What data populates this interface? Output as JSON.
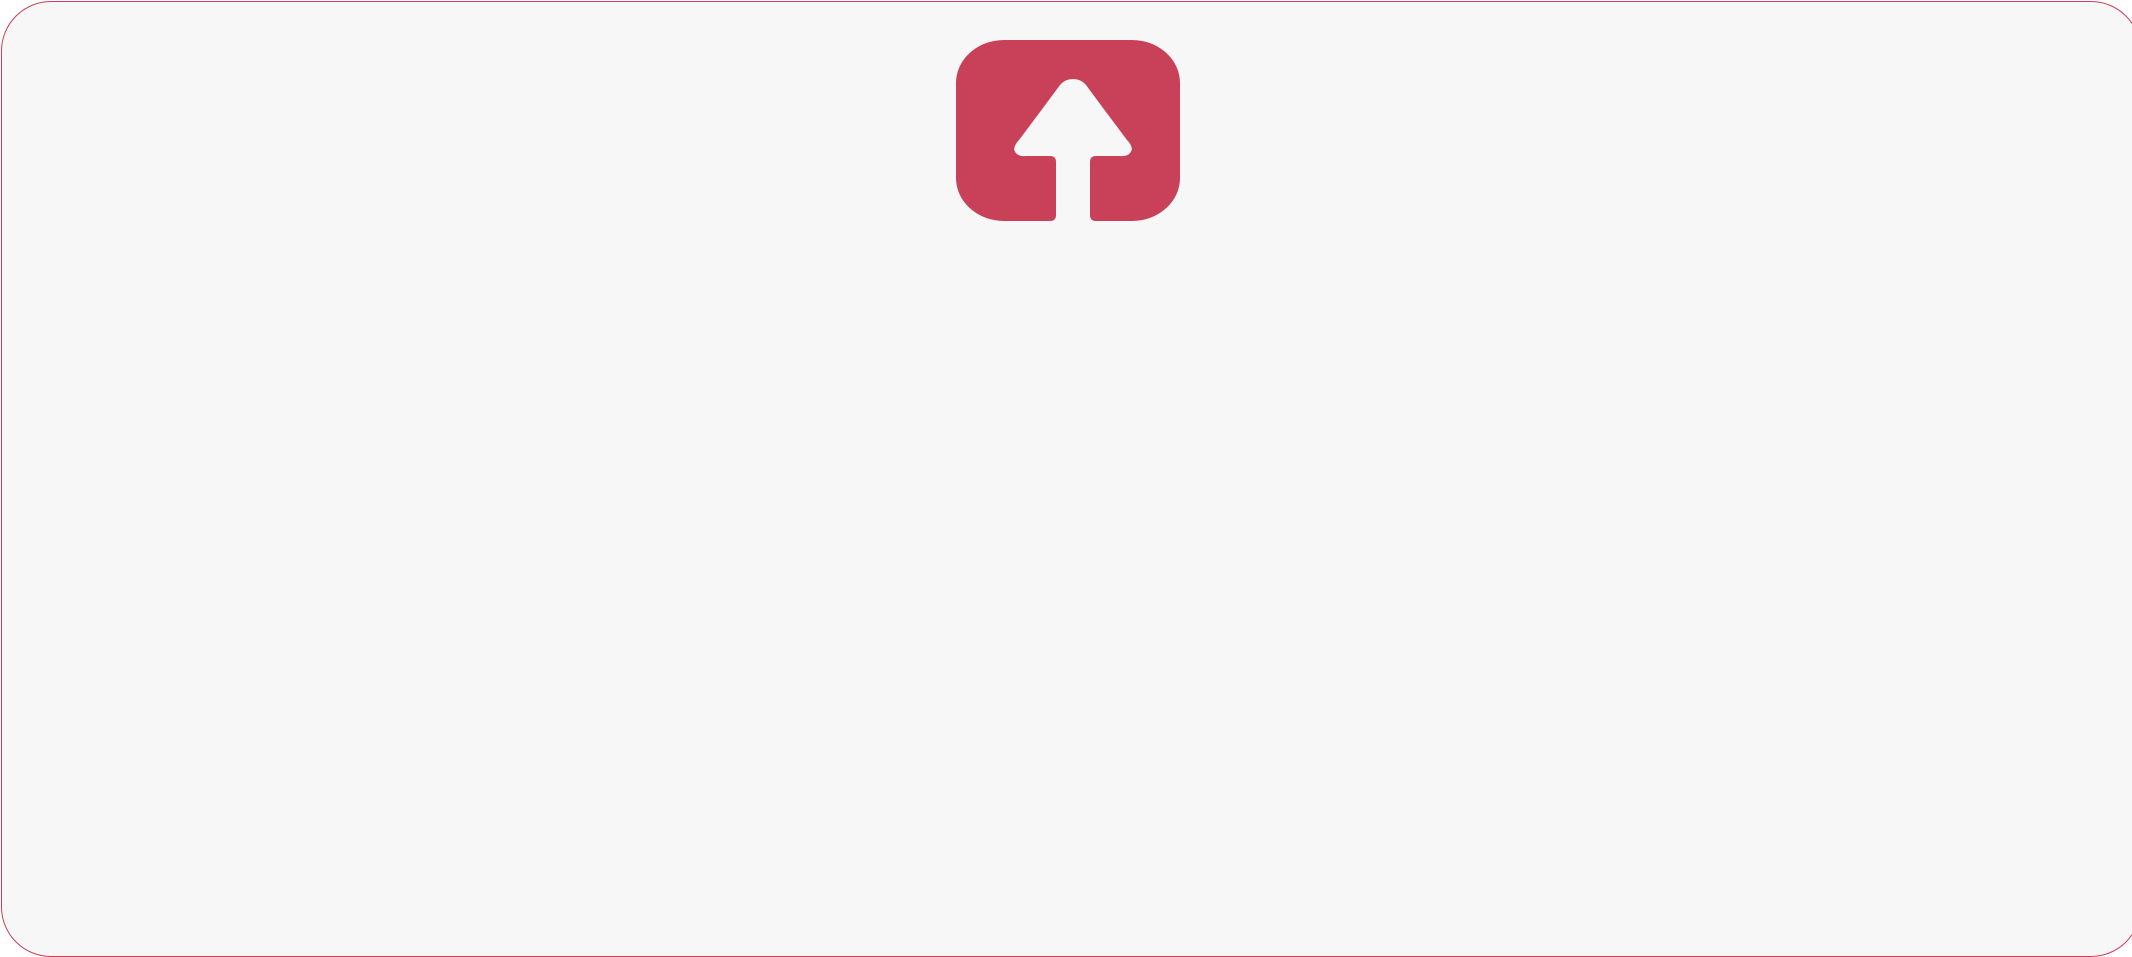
{
  "upload_zone": {
    "icon": "upload-arrow-icon",
    "border_color": "#c9415a",
    "icon_color": "#c84158",
    "background_color": "#f7f7f7"
  }
}
